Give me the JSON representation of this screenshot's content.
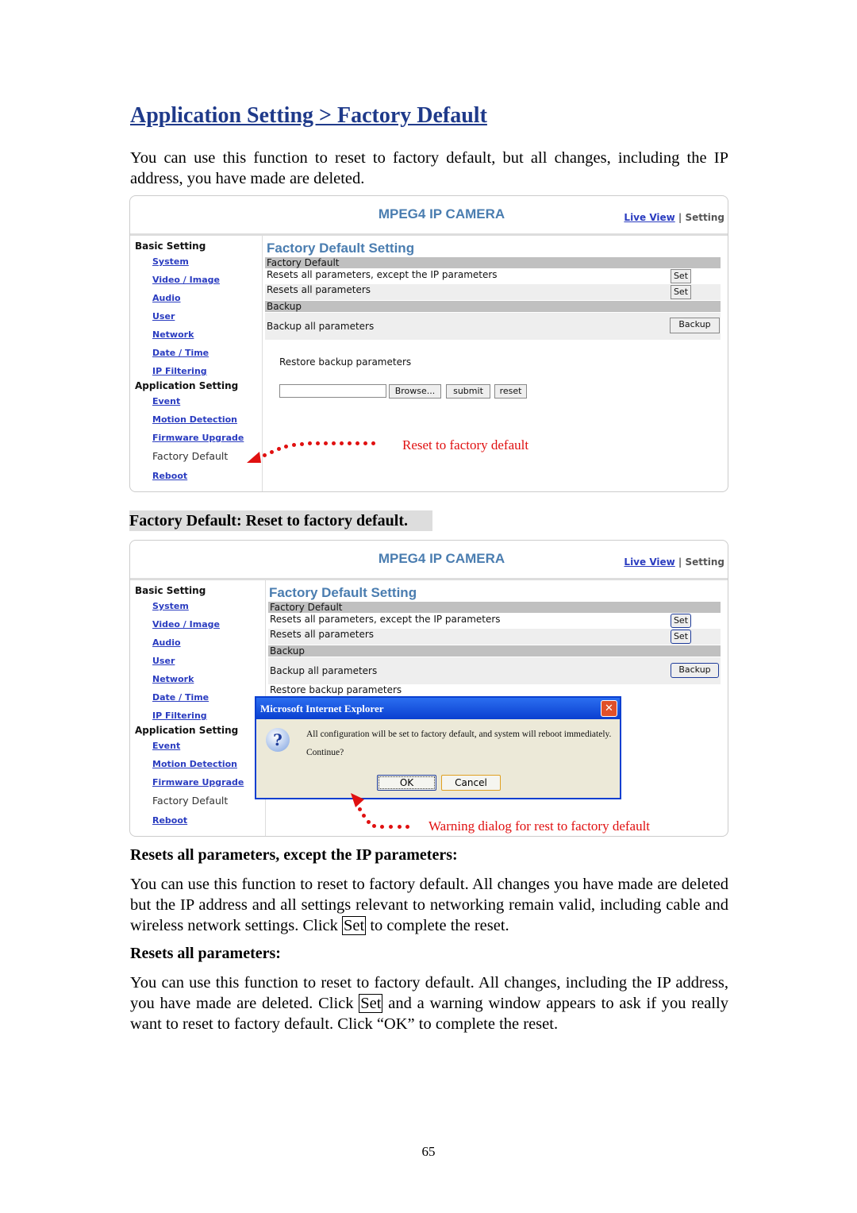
{
  "heading": "Application Setting > Factory Default",
  "intro": "You can use this function to reset to factory default, but all changes, including the IP address, you have made are deleted.",
  "camera_ui": {
    "product_title": "MPEG4 IP CAMERA",
    "nav": {
      "live_view": "Live View",
      "separator": "|",
      "setting": "Setting"
    },
    "sidebar": {
      "basic_heading": "Basic Setting",
      "basic_items": [
        "System",
        "Video / Image",
        "Audio",
        "User",
        "Network",
        "Date / Time",
        "IP Filtering"
      ],
      "app_heading": "Application Setting",
      "app_items": [
        "Event",
        "Motion Detection",
        "Firmware Upgrade",
        "Factory Default",
        "Reboot"
      ],
      "current": "Factory Default"
    },
    "content": {
      "title": "Factory Default Setting",
      "section_factory": "Factory Default",
      "row_except_ip": "Resets all parameters, except the IP parameters",
      "row_all": "Resets all parameters",
      "set_label": "Set",
      "section_backup": "Backup",
      "row_backup": "Backup all parameters",
      "backup_label": "Backup",
      "restore_label": "Restore backup parameters",
      "restore_file_value": "",
      "browse_label": "Browse...",
      "submit_label": "submit",
      "reset_label": "reset"
    }
  },
  "annotation1": "Reset to factory default",
  "caption": "Factory Default: Reset to factory default.",
  "dialog": {
    "title": "Microsoft Internet Explorer",
    "message": "All configuration will be set to factory default, and system will reboot immediately.",
    "question": "Continue?",
    "ok": "OK",
    "cancel": "Cancel",
    "close": "✕",
    "icon": "question-icon"
  },
  "annotation2": "Warning dialog for rest to factory default",
  "section1": {
    "heading": "Resets all parameters, except the IP parameters:",
    "text_before": "You can use this function to reset to factory default. All changes you have made are deleted but the IP address and all settings relevant to networking remain valid, including cable and wireless network settings. Click ",
    "button": "Set",
    "text_after": " to complete the reset."
  },
  "section2": {
    "heading": "Resets all parameters:",
    "text_before": "You can use this function to reset to factory default. All changes, including the IP address, you have made are deleted. Click ",
    "button": "Set",
    "text_after": " and a warning window appears to ask if you really want to reset to factory default. Click “OK” to complete the reset."
  },
  "page_number": "65",
  "colors": {
    "heading": "#1f3a8a",
    "annotation": "#e01010",
    "link": "#2a3cc0",
    "camera_title": "#4a7db0",
    "dialog_titlebar": "#0a3fd0"
  }
}
